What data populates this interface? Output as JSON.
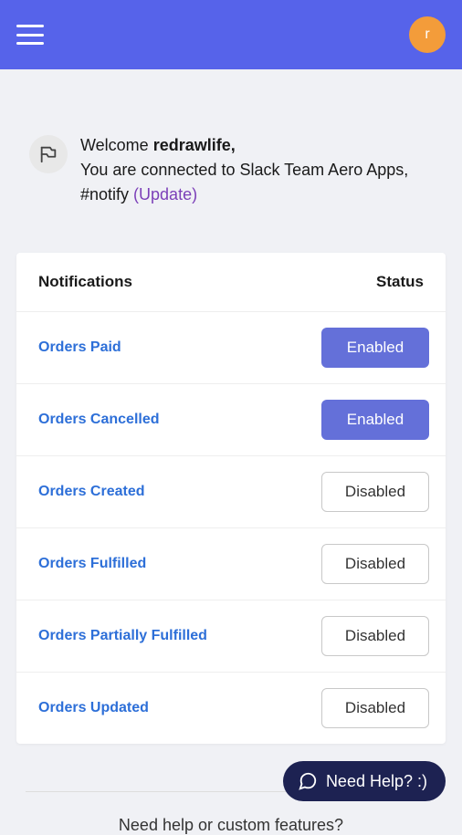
{
  "header": {
    "avatar_letter": "r"
  },
  "welcome": {
    "prefix": "Welcome ",
    "username": "redrawlife,",
    "line2_part1": "You are connected to Slack Team Aero Apps, #notify ",
    "update_link": "(Update)"
  },
  "card": {
    "header_left": "Notifications",
    "header_right": "Status"
  },
  "notifications": [
    {
      "name": "Orders Paid",
      "status": "Enabled",
      "enabled": true
    },
    {
      "name": "Orders Cancelled",
      "status": "Enabled",
      "enabled": true
    },
    {
      "name": "Orders Created",
      "status": "Disabled",
      "enabled": false
    },
    {
      "name": "Orders Fulfilled",
      "status": "Disabled",
      "enabled": false
    },
    {
      "name": "Orders Partially Fulfilled",
      "status": "Disabled",
      "enabled": false
    },
    {
      "name": "Orders Updated",
      "status": "Disabled",
      "enabled": false
    }
  ],
  "help": {
    "footer_text": "Need help or custom features?",
    "widget_text": "Need Help? :)"
  }
}
